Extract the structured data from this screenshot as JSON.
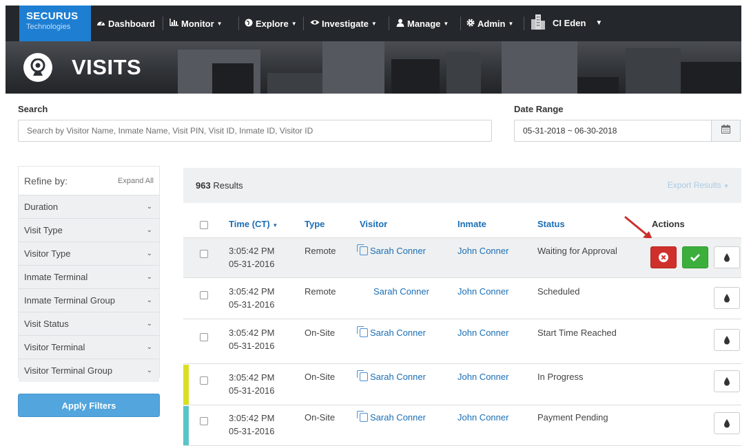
{
  "nav": {
    "logo_line1": "SECURUS",
    "logo_line2": "Technologies",
    "items": [
      {
        "label": "Dashboard",
        "icon": "dashboard-icon"
      },
      {
        "label": "Monitor",
        "icon": "chart-icon"
      },
      {
        "label": "Explore",
        "icon": "globe-icon"
      },
      {
        "label": "Investigate",
        "icon": "eye-icon"
      },
      {
        "label": "Manage",
        "icon": "user-icon"
      },
      {
        "label": "Admin",
        "icon": "gear-icon"
      }
    ],
    "user": "CI Eden"
  },
  "page": {
    "title": "VISITS"
  },
  "search": {
    "label": "Search",
    "placeholder": "Search by Visitor Name, Inmate Name, Visit PIN, Visit ID, Inmate ID, Visitor ID",
    "date_label": "Date Range",
    "date_value": "05-31-2018 ~ 06-30-2018"
  },
  "refine": {
    "title": "Refine by:",
    "expand_all": "Expand All",
    "filters": [
      "Duration",
      "Visit Type",
      "Visitor Type",
      "Inmate Terminal",
      "Inmate Terminal Group",
      "Visit Status",
      "Visitor Terminal",
      "Visitor Terminal Group"
    ],
    "apply": "Apply Filters"
  },
  "results": {
    "count": "963",
    "count_label": "Results",
    "export": "Export Results"
  },
  "table": {
    "headers": {
      "time": "Time (CT)",
      "type": "Type",
      "visitor": "Visitor",
      "inmate": "Inmate",
      "status": "Status",
      "actions": "Actions"
    },
    "rows": [
      {
        "time": "3:05:42 PM",
        "date": "05-31-2016",
        "type": "Remote",
        "visitor": "Sarah Conner",
        "inmate": "John Conner",
        "status": "Waiting for Approval"
      },
      {
        "time": "3:05:42 PM",
        "date": "05-31-2016",
        "type": "Remote",
        "visitor": "Sarah Conner",
        "inmate": "John Conner",
        "status": "Scheduled"
      },
      {
        "time": "3:05:42 PM",
        "date": "05-31-2016",
        "type": "On-Site",
        "visitor": "Sarah Conner",
        "inmate": "John Conner",
        "status": "Start Time Reached"
      },
      {
        "time": "3:05:42 PM",
        "date": "05-31-2016",
        "type": "On-Site",
        "visitor": "Sarah Conner",
        "inmate": "John Conner",
        "status": "In Progress"
      },
      {
        "time": "3:05:42 PM",
        "date": "05-31-2016",
        "type": "On-Site",
        "visitor": "Sarah Conner",
        "inmate": "John Conner",
        "status": "Payment Pending"
      }
    ]
  },
  "colors": {
    "brand": "#1e7fd2",
    "link": "#1a6eb5",
    "deny": "#d0302c",
    "approve": "#3cae3c",
    "in_progress": "#d9e021",
    "payment_pending": "#5bc4c8"
  }
}
